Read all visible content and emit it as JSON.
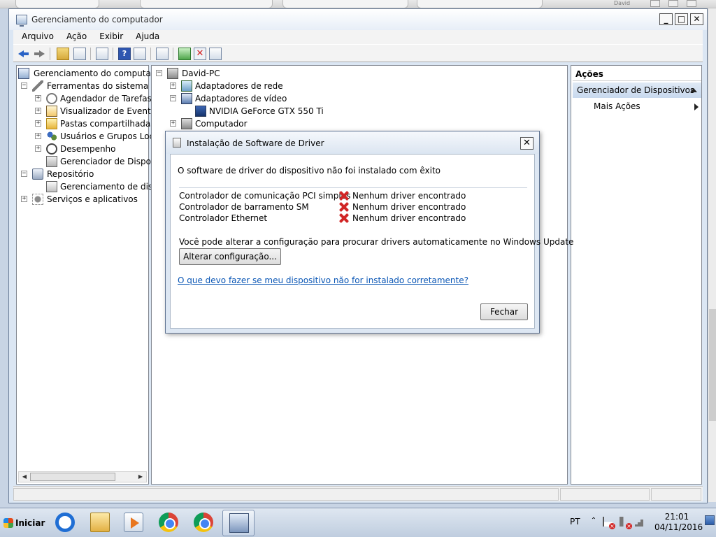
{
  "background": {
    "user_label": "David"
  },
  "window": {
    "title": "Gerenciamento do computador",
    "buttons": {
      "minimize": "_",
      "maximize": "□",
      "close": "✕"
    }
  },
  "menu": [
    "Arquivo",
    "Ação",
    "Exibir",
    "Ajuda"
  ],
  "toolbar_icons": [
    "back-arrow-icon",
    "forward-arrow-icon",
    "up-folder-icon",
    "show-hide-tree-icon",
    "properties-icon",
    "help-icon",
    "show-hide-action-pane-icon",
    "scan-hardware-icon",
    "update-driver-icon",
    "disable-device-icon",
    "uninstall-device-icon"
  ],
  "left_tree": [
    {
      "label": "Gerenciamento do computador",
      "icon": "computer-management-icon",
      "expander": ""
    },
    {
      "label": "Ferramentas do sistema",
      "icon": "system-tools-icon",
      "expander": "⊟"
    },
    {
      "label": "Agendador de Tarefas",
      "icon": "task-scheduler-icon",
      "expander": "⊞"
    },
    {
      "label": "Visualizador de Eventos",
      "icon": "event-viewer-icon",
      "expander": "⊞"
    },
    {
      "label": "Pastas compartilhadas",
      "icon": "shared-folders-icon",
      "expander": "⊞"
    },
    {
      "label": "Usuários e Grupos Loca",
      "icon": "local-users-icon",
      "expander": "⊞"
    },
    {
      "label": "Desempenho",
      "icon": "performance-icon",
      "expander": "⊞"
    },
    {
      "label": "Gerenciador de Disposit",
      "icon": "device-manager-icon",
      "expander": ""
    },
    {
      "label": "Repositório",
      "icon": "storage-icon",
      "expander": "⊟"
    },
    {
      "label": "Gerenciamento de disco",
      "icon": "disk-management-icon",
      "expander": ""
    },
    {
      "label": "Serviços e aplicativos",
      "icon": "services-icon",
      "expander": "⊞"
    }
  ],
  "device_tree": [
    {
      "label": "David-PC",
      "icon": "computer-icon",
      "expander": "⊟"
    },
    {
      "label": "Adaptadores de rede",
      "icon": "network-adapter-icon",
      "expander": "⊞"
    },
    {
      "label": "Adaptadores de vídeo",
      "icon": "display-adapter-icon",
      "expander": "⊟"
    },
    {
      "label": "NVIDIA GeForce GTX 550 Ti",
      "icon": "display-device-icon",
      "expander": ""
    },
    {
      "label": "Computador",
      "icon": "pc-icon",
      "expander": "⊞"
    }
  ],
  "actions": {
    "header": "Ações",
    "section": "Gerenciador de Dispositivos",
    "item": "Mais Ações"
  },
  "dialog": {
    "title": "Instalação de Software de Driver",
    "message": "O software de driver do dispositivo não foi instalado com êxito",
    "devices": [
      {
        "name": "Controlador de comunicação PCI simples",
        "status": "Nenhum driver encontrado"
      },
      {
        "name": "Controlador de barramento SM",
        "status": "Nenhum driver encontrado"
      },
      {
        "name": "Controlador Ethernet",
        "status": "Nenhum driver encontrado"
      }
    ],
    "note": "Você pode alterar a configuração para procurar drivers automaticamente no Windows Update",
    "change_button": "Alterar configuração...",
    "help_link": "O que devo fazer se meu dispositivo não for instalado corretamente?",
    "close_button": "Fechar"
  },
  "taskbar": {
    "start_label": "Iniciar",
    "apps": [
      "internet-explorer-icon",
      "windows-explorer-icon",
      "media-player-icon",
      "chrome-icon",
      "chrome-icon",
      "computer-management-icon"
    ],
    "language": "PT",
    "time": "21:01",
    "date": "04/11/2016"
  }
}
